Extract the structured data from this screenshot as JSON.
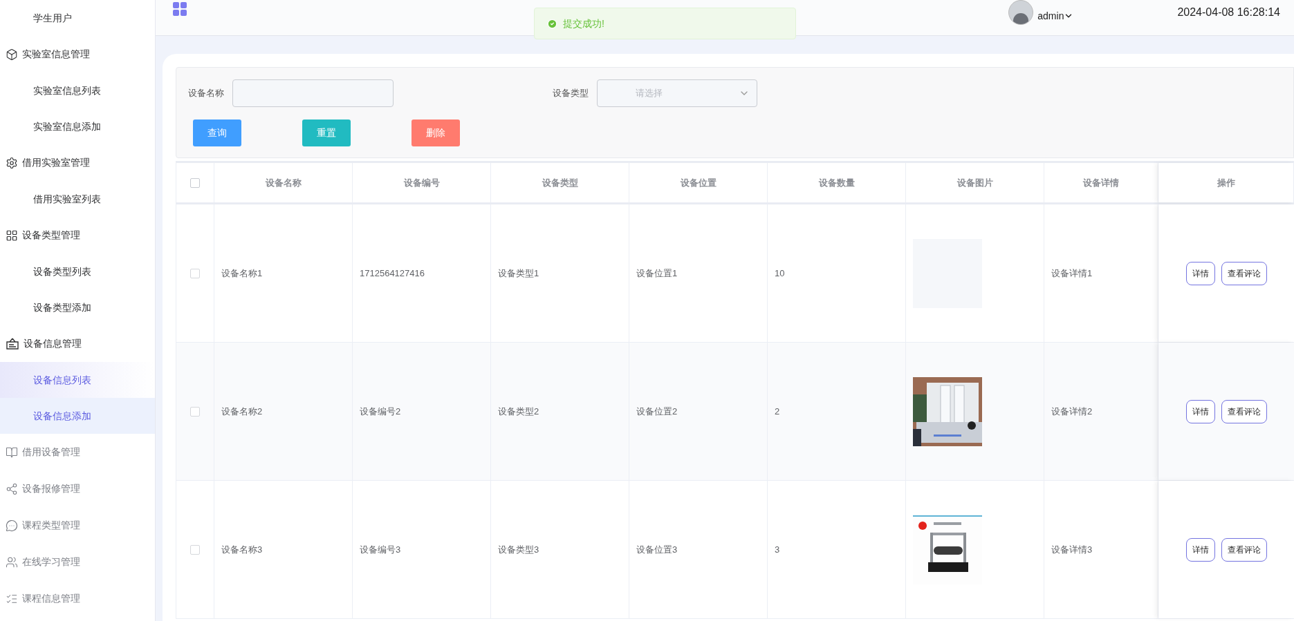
{
  "sidebar": {
    "items": [
      {
        "kind": "subitem",
        "label": "学生用户",
        "selected": false,
        "hovered": false
      },
      {
        "kind": "group",
        "label": "实验室信息管理",
        "expanded": true,
        "children": [
          {
            "label": "实验室信息列表",
            "selected": false,
            "hovered": false
          },
          {
            "label": "实验室信息添加",
            "selected": false,
            "hovered": false
          }
        ]
      },
      {
        "kind": "group",
        "label": "借用实验室管理",
        "expanded": true,
        "children": [
          {
            "label": "借用实验室列表",
            "selected": false,
            "hovered": false
          }
        ]
      },
      {
        "kind": "group",
        "label": "设备类型管理",
        "expanded": true,
        "children": [
          {
            "label": "设备类型列表",
            "selected": false,
            "hovered": false
          },
          {
            "label": "设备类型添加",
            "selected": false,
            "hovered": false
          }
        ]
      },
      {
        "kind": "group",
        "label": "设备信息管理",
        "expanded": true,
        "children": [
          {
            "label": "设备信息列表",
            "selected": true,
            "hovered": false
          },
          {
            "label": "设备信息添加",
            "selected": false,
            "hovered": true
          }
        ]
      },
      {
        "kind": "group",
        "label": "借用设备管理",
        "expanded": false
      },
      {
        "kind": "group",
        "label": "设备报修管理",
        "expanded": false
      },
      {
        "kind": "group",
        "label": "课程类型管理",
        "expanded": false
      },
      {
        "kind": "group",
        "label": "在线学习管理",
        "expanded": false
      },
      {
        "kind": "group",
        "label": "课程信息管理",
        "expanded": false
      }
    ]
  },
  "header": {
    "user": "admin",
    "datetime": "2024-04-08 16:28:14"
  },
  "toast": {
    "message": "提交成功!"
  },
  "filters": [
    {
      "kind": "input",
      "label": "设备名称"
    },
    {
      "kind": "select",
      "label": "设备类型",
      "placeholder": "请选择"
    }
  ],
  "buttons": [
    {
      "label": "查询",
      "color": "#409eff"
    },
    {
      "label": "重置",
      "color": "#21bbc1"
    },
    {
      "label": "删除",
      "color": "#ff7b6e"
    }
  ],
  "table": {
    "select_all": {
      "checked": false
    },
    "columns": [
      "设备名称",
      "设备编号",
      "设备类型",
      "设备位置",
      "设备数量",
      "设备图片",
      "设备详情",
      "操作"
    ],
    "rows": [
      {
        "checked": false,
        "cells": [
          "设备名称1",
          "1712564127416",
          "设备类型1",
          "设备位置1",
          "10"
        ],
        "image": {
          "kind": "empty"
        },
        "detail": "设备详情1",
        "actions": [
          "详情",
          "查看评论"
        ]
      },
      {
        "checked": false,
        "cells": [
          "设备名称2",
          "设备编号2",
          "设备类型2",
          "设备位置2",
          "2"
        ],
        "image": {
          "kind": "apparatus"
        },
        "detail": "设备详情2",
        "actions": [
          "详情",
          "查看评论"
        ]
      },
      {
        "checked": false,
        "cells": [
          "设备名称3",
          "设备编号3",
          "设备类型3",
          "设备位置3",
          "3"
        ],
        "image": {
          "kind": "pendulum"
        },
        "detail": "设备详情3",
        "actions": [
          "详情",
          "查看评论"
        ]
      }
    ]
  }
}
